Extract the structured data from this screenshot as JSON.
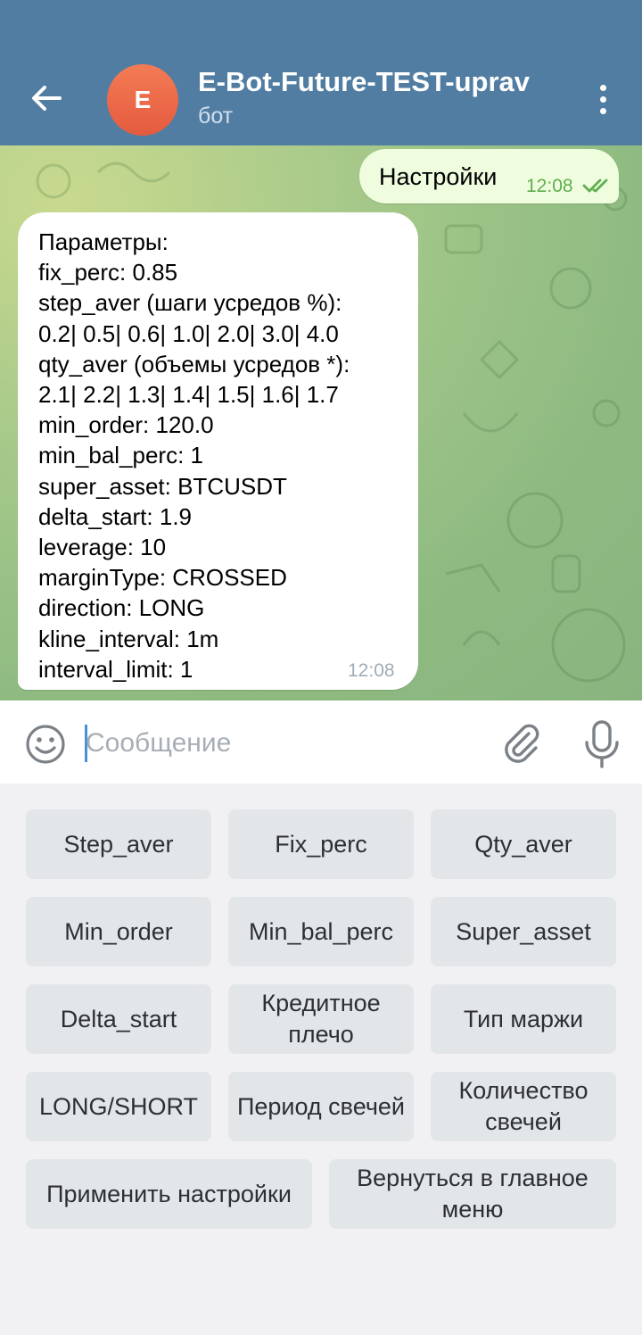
{
  "header": {
    "avatar_letter": "E",
    "title": "E-Bot-Future-TEST-uprav",
    "subtitle": "бот",
    "icons": {
      "back": "arrow-left-icon",
      "menu": "more-vertical-icon"
    },
    "colors": {
      "bar": "#517da2",
      "avatar": "#e9603f"
    }
  },
  "messages": {
    "outgoing": {
      "text": "Настройки",
      "time": "12:08",
      "status": "read"
    },
    "incoming": {
      "text": "Параметры:\nfix_perc: 0.85\nstep_aver (шаги усредов %):\n0.2| 0.5| 0.6| 1.0| 2.0| 3.0| 4.0\nqty_aver (объемы усредов *):\n2.1| 2.2| 1.3| 1.4| 1.5| 1.6| 1.7\nmin_order: 120.0\nmin_bal_perc: 1\nsuper_asset: BTCUSDT\ndelta_start: 1.9\nleverage: 10\nmarginType: CROSSED\ndirection: LONG\nkline_interval: 1m\ninterval_limit: 1",
      "time": "12:08"
    }
  },
  "composer": {
    "placeholder": "Сообщение",
    "icons": {
      "emoji": "emoji-icon",
      "attach": "paperclip-icon",
      "mic": "microphone-icon"
    }
  },
  "keyboard": {
    "step_aver": "Step_aver",
    "fix_perc": "Fix_perc",
    "qty_aver": "Qty_aver",
    "min_order": "Min_order",
    "min_bal_perc": "Min_bal_perc",
    "super_asset": "Super_asset",
    "delta_start": "Delta_start",
    "leverage": "Кредитное плечо",
    "margin_type": "Тип маржи",
    "long_short": "LONG/SHORT",
    "candle_period": "Период свечей",
    "candle_count": "Количество свечей",
    "apply": "Применить настройки",
    "back_main": "Вернуться в главное меню"
  }
}
